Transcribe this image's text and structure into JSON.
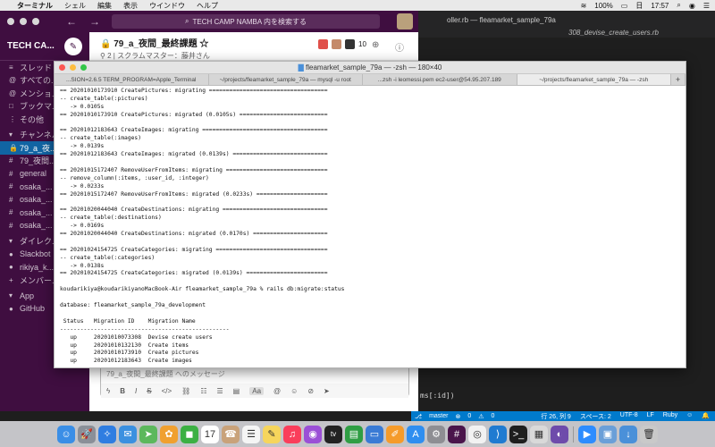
{
  "menubar": {
    "apple": "",
    "app_name": "ターミナル",
    "items": [
      "シェル",
      "編集",
      "表示",
      "ウインドウ",
      "ヘルプ"
    ],
    "battery": "100%",
    "day": "日",
    "time": "17:57"
  },
  "vscode": {
    "tab1": "oller.rb — fleamarket_sample_79a",
    "tab2": "308_devise_create_users.rb",
    "code_fragment": "ms[:id])",
    "status": {
      "branch": "master",
      "errors": "0",
      "warnings": "0",
      "position": "行 26, 列 9",
      "spaces": "スペース: 2",
      "encoding": "UTF-8",
      "eol": "LF",
      "language": "Ruby"
    }
  },
  "slack": {
    "search_placeholder": "TECH CAMP NAMBA 内を検索する",
    "workspace": "TECH CA...",
    "channel_title": "79_a_夜間_最終課題",
    "channel_sub_members": "2",
    "channel_sub": "スクラムマスター：藤井さん",
    "member_count": "10",
    "sidebar": [
      {
        "icon": "≡",
        "label": "スレッド",
        "active": false
      },
      {
        "icon": "@",
        "label": "すべての...",
        "active": false
      },
      {
        "icon": "@",
        "label": "メンショ...",
        "active": false
      },
      {
        "icon": "□",
        "label": "ブックマ...",
        "active": false
      },
      {
        "icon": "⋮",
        "label": "その他",
        "active": false
      },
      {
        "icon": "▾",
        "label": "チャンネル",
        "active": false,
        "section": true
      },
      {
        "icon": "🔒",
        "label": "79_a_夜...",
        "active": true
      },
      {
        "icon": "#",
        "label": "79_夜間...",
        "active": false
      },
      {
        "icon": "#",
        "label": "general",
        "active": false
      },
      {
        "icon": "#",
        "label": "osaka_...",
        "active": false
      },
      {
        "icon": "#",
        "label": "osaka_...",
        "active": false
      },
      {
        "icon": "#",
        "label": "osaka_...",
        "active": false
      },
      {
        "icon": "#",
        "label": "osaka_...",
        "active": false
      },
      {
        "icon": "▾",
        "label": "ダイレク...",
        "active": false,
        "section": true
      },
      {
        "icon": "●",
        "label": "Slackbot",
        "active": false
      },
      {
        "icon": "●",
        "label": "rikiya_k...",
        "active": false
      },
      {
        "icon": "+",
        "label": "メンバー...",
        "active": false
      },
      {
        "icon": "▾",
        "label": "App",
        "active": false,
        "section": true
      },
      {
        "icon": "●",
        "label": "GitHub",
        "active": false
      }
    ],
    "composer_placeholder": "79_a_夜間_最終課題 へのメッセージ",
    "composer_aa": "Aa"
  },
  "terminal": {
    "title_folder": "fleamarket_sample_79a",
    "title_rest": " — -zsh — 180×40",
    "tabs": [
      {
        "label": "...SION=2.6.5 TERM_PROGRAM=Apple_Terminal",
        "active": false
      },
      {
        "label": "~/projects/fleamarket_sample_79a — mysql -u root",
        "active": false
      },
      {
        "label": "...zsh -i leomessi.pem ec2-user@54.95.207.189",
        "active": false
      },
      {
        "label": "~/projects/fleamarket_sample_79a — -zsh",
        "active": true
      },
      {
        "label": "+",
        "active": false
      }
    ],
    "lines": [
      "== 20201010173910 CreatePictures: migrating ===================================",
      "-- create_table(:pictures)",
      "   -> 0.0105s",
      "== 20201010173910 CreatePictures: migrated (0.0105s) ==========================",
      "",
      "== 20201012183643 CreateImages: migrating =====================================",
      "-- create_table(:images)",
      "   -> 0.0139s",
      "== 20201012183643 CreateImages: migrated (0.0139s) ============================",
      "",
      "== 20201015172407 RemoveUserFromItems: migrating ==============================",
      "-- remove_column(:items, :user_id, :integer)",
      "   -> 0.0233s",
      "== 20201015172407 RemoveUserFromItems: migrated (0.0233s) =====================",
      "",
      "== 20201020044040 CreateDestinations: migrating ===============================",
      "-- create_table(:destinations)",
      "   -> 0.0169s",
      "== 20201020044040 CreateDestinations: migrated (0.0170s) ======================",
      "",
      "== 20201024154725 CreateCategories: migrating =================================",
      "-- create_table(:categories)",
      "   -> 0.0138s",
      "== 20201024154725 CreateCategories: migrated (0.0139s) ========================",
      "",
      "koudarikiya@koudarikiyanoMacBook-Air fleamarket_sample_79a % rails db:migrate:status",
      "",
      "database: fleamarket_sample_79a_development",
      "",
      " Status   Migration ID    Migration Name",
      "--------------------------------------------------",
      "   up     20201010073308  Devise create users",
      "   up     20201010132130  Create items",
      "   up     20201010173910  Create pictures",
      "   up     20201012183643  Create images",
      "   up     20201015172407  Remove user from items",
      "   up     20201020044040  Create destinations",
      "   up     20201024154725  Create categories",
      "",
      "koudarikiya@koudarikiyanoMacBook-Air fleamarket_sample_79a % "
    ]
  },
  "dock": [
    {
      "name": "finder",
      "color": "#3a8ee6",
      "glyph": "☺"
    },
    {
      "name": "launchpad",
      "color": "#8a8f98",
      "glyph": "🚀"
    },
    {
      "name": "safari",
      "color": "#2f7de1",
      "glyph": "✧"
    },
    {
      "name": "mail",
      "color": "#3b90e0",
      "glyph": "✉"
    },
    {
      "name": "maps",
      "color": "#5cb85c",
      "glyph": "➤"
    },
    {
      "name": "photos",
      "color": "#f0a030",
      "glyph": "✿"
    },
    {
      "name": "facetime",
      "color": "#3cb043",
      "glyph": "◼"
    },
    {
      "name": "calendar",
      "color": "#ffffff",
      "glyph": "17"
    },
    {
      "name": "contacts",
      "color": "#c9a27a",
      "glyph": "☎"
    },
    {
      "name": "reminders",
      "color": "#f5f5f5",
      "glyph": "☰"
    },
    {
      "name": "notes",
      "color": "#f6d55c",
      "glyph": "✎"
    },
    {
      "name": "music",
      "color": "#fa3e5b",
      "glyph": "♫"
    },
    {
      "name": "podcasts",
      "color": "#9b4fd6",
      "glyph": "◉"
    },
    {
      "name": "tv",
      "color": "#222222",
      "glyph": "tv"
    },
    {
      "name": "numbers",
      "color": "#2f9e44",
      "glyph": "▤"
    },
    {
      "name": "keynote",
      "color": "#3a7bd5",
      "glyph": "▭"
    },
    {
      "name": "pages",
      "color": "#f59b2b",
      "glyph": "✐"
    },
    {
      "name": "app-store",
      "color": "#2f8ef0",
      "glyph": "A"
    },
    {
      "name": "system-preferences",
      "color": "#8e8e93",
      "glyph": "⚙"
    },
    {
      "name": "slack",
      "color": "#4a154b",
      "glyph": "#"
    },
    {
      "name": "chrome",
      "color": "#f2f2f2",
      "glyph": "◎"
    },
    {
      "name": "vscode",
      "color": "#1f7bd1",
      "glyph": "⟩"
    },
    {
      "name": "terminal",
      "color": "#1e1e1e",
      "glyph": ">_"
    },
    {
      "name": "sequel-pro",
      "color": "#d9d9d9",
      "glyph": "▦"
    },
    {
      "name": "github-desktop",
      "color": "#6e4bab",
      "glyph": "◐"
    },
    {
      "name": "sep",
      "color": "",
      "glyph": ""
    },
    {
      "name": "zoom",
      "color": "#2d8cff",
      "glyph": "▶"
    },
    {
      "name": "preview",
      "color": "#6a9fd8",
      "glyph": "▣"
    },
    {
      "name": "downloads",
      "color": "#4a90d9",
      "glyph": "↓"
    },
    {
      "name": "trash",
      "color": "#c9c9c9",
      "glyph": "🗑"
    }
  ]
}
